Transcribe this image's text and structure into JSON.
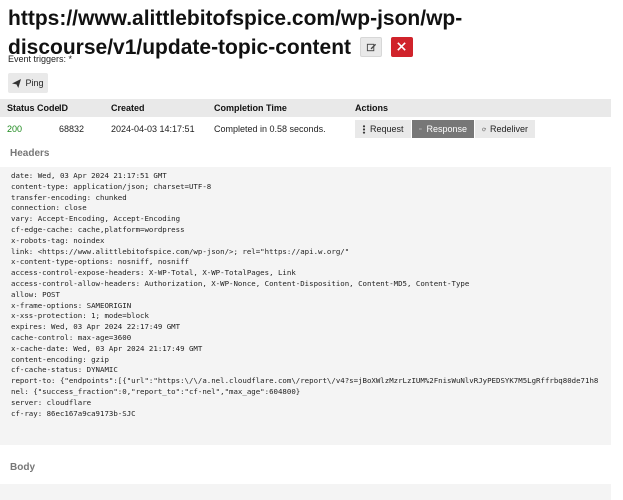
{
  "page": {
    "title": "https://www.alittlebitofspice.com/wp-json/wp-discourse/v1/update-topic-content",
    "event_triggers_label": "Event triggers: *",
    "ping_label": "Ping"
  },
  "table": {
    "columns": [
      "Status Code",
      "ID",
      "Created",
      "Completion Time",
      "Actions"
    ],
    "row": {
      "status_code": "200",
      "id": "68832",
      "created": "2024-04-03 14:17:51",
      "completion_time": "Completed in 0.58 seconds.",
      "actions": {
        "request": "Request",
        "response": "Response",
        "redeliver": "Redeliver"
      }
    }
  },
  "headers_section": {
    "title": "Headers",
    "lines": [
      "date: Wed, 03 Apr 2024 21:17:51 GMT",
      "content-type: application/json; charset=UTF-8",
      "transfer-encoding: chunked",
      "connection: close",
      "vary: Accept-Encoding, Accept-Encoding",
      "cf-edge-cache: cache,platform=wordpress",
      "x-robots-tag: noindex",
      "link: <https://www.alittlebitofspice.com/wp-json/>; rel=\"https://api.w.org/\"",
      "x-content-type-options: nosniff, nosniff",
      "access-control-expose-headers: X-WP-Total, X-WP-TotalPages, Link",
      "access-control-allow-headers: Authorization, X-WP-Nonce, Content-Disposition, Content-MD5, Content-Type",
      "allow: POST",
      "x-frame-options: SAMEORIGIN",
      "x-xss-protection: 1; mode=block",
      "expires: Wed, 03 Apr 2024 22:17:49 GMT",
      "cache-control: max-age=3600",
      "x-cache-date: Wed, 03 Apr 2024 21:17:49 GMT",
      "content-encoding: gzip",
      "cf-cache-status: DYNAMIC",
      "report-to: {\"endpoints\":[{\"url\":\"https:\\/\\/a.nel.cloudflare.com\\/report\\/v4?s=jBoXWlzMzrLzIUM%2FnisWuNlvRJyPEDSYK7M5LgRffrbq80de71h8",
      "nel: {\"success_fraction\":0,\"report_to\":\"cf-nel\",\"max_age\":604800}",
      "server: cloudflare",
      "cf-ray: 86ec167a9ca9173b-SJC"
    ]
  },
  "body_section": {
    "title": "Body"
  },
  "colors": {
    "delete": "#d0232b",
    "success": "#1e8a1e",
    "active_button": "#777777",
    "panel": "#f4f4f4"
  }
}
